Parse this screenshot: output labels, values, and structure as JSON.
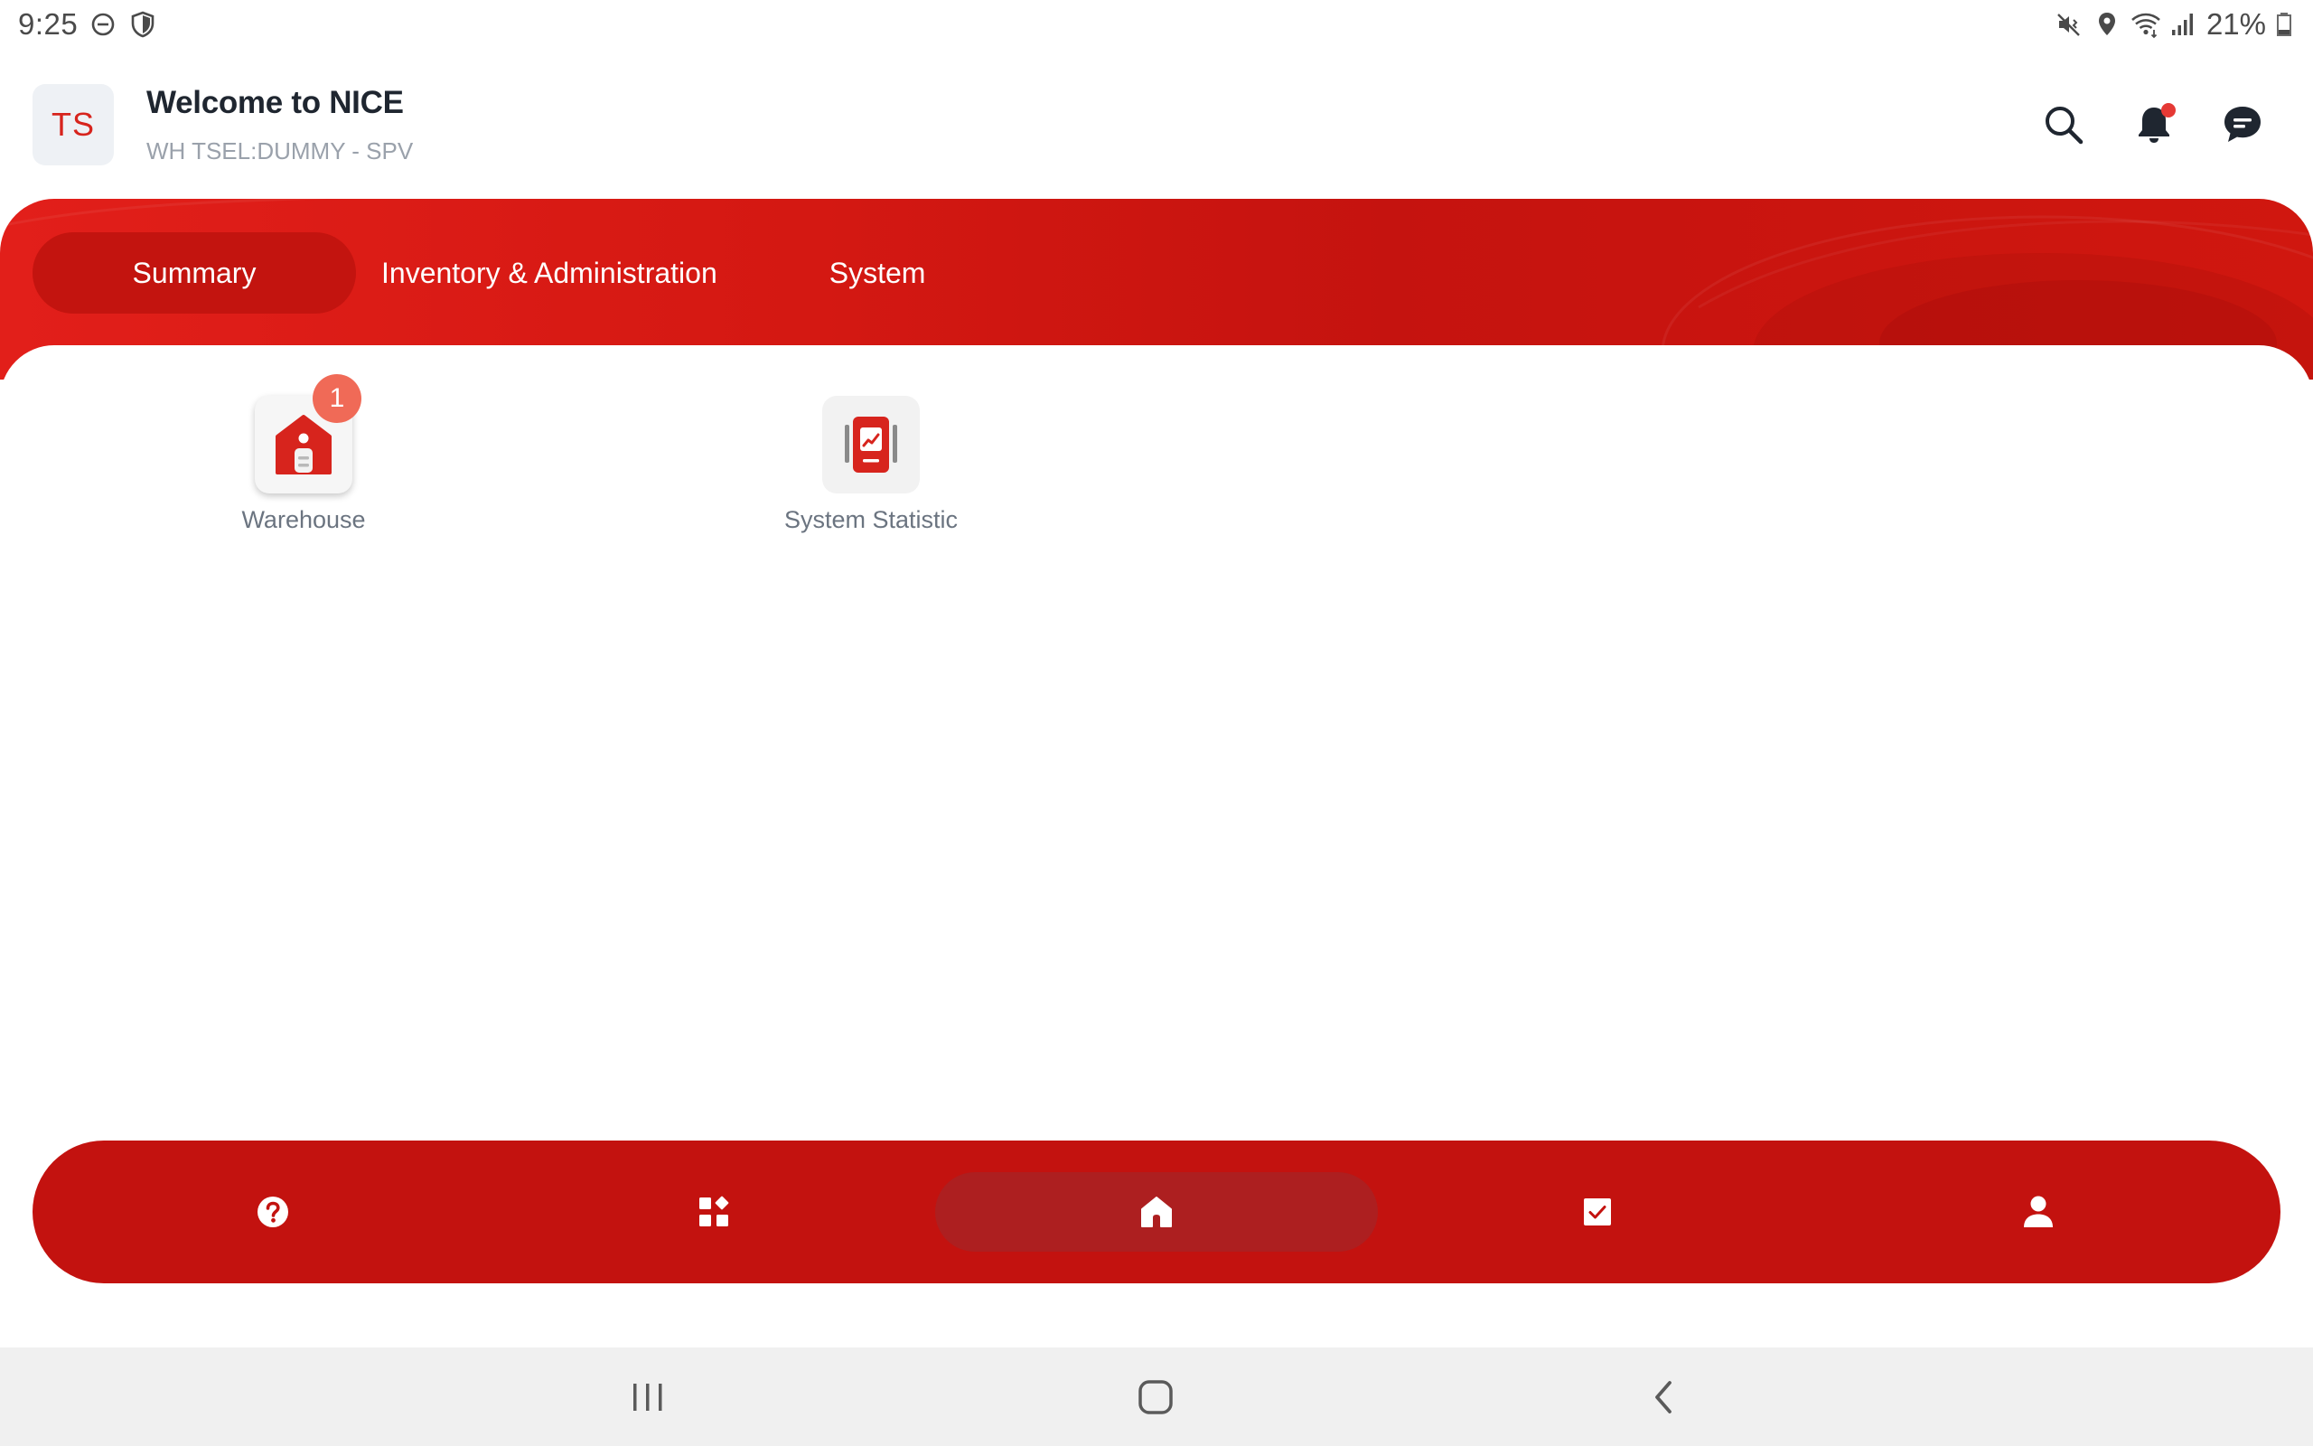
{
  "status_bar": {
    "time": "9:25",
    "battery_text": "21%",
    "left_icons": [
      "dnd-icon",
      "shield-icon"
    ],
    "right_icons": [
      "mute-vibrate-icon",
      "location-icon",
      "wifi-icon",
      "signal-icon",
      "battery-icon"
    ]
  },
  "header": {
    "avatar_initials": "TS",
    "title": "Welcome to NICE",
    "subtitle": "WH TSEL:DUMMY - SPV",
    "icons": [
      "search-icon",
      "bell-icon",
      "chat-icon"
    ],
    "has_notification": true
  },
  "tabs": [
    {
      "label": "Summary",
      "active": true
    },
    {
      "label": "Inventory & Administration",
      "active": false
    },
    {
      "label": "System",
      "active": false
    }
  ],
  "menu_items": [
    {
      "label": "Warehouse",
      "icon": "warehouse-icon",
      "badge": "1"
    },
    {
      "label": "System Statistic",
      "icon": "statistic-book-icon",
      "badge": ""
    }
  ],
  "bottom_nav": {
    "items": [
      "help-icon",
      "apps-icon",
      "home-icon",
      "tasks-icon",
      "profile-icon"
    ],
    "active": "home-icon"
  },
  "system_nav": [
    "recents-icon",
    "home-circle-icon",
    "back-icon"
  ],
  "colors": {
    "brand_red": "#c3120f",
    "active_pill": "#ad1f20",
    "badge": "#f06a57",
    "avatar_text": "#d7241d"
  }
}
